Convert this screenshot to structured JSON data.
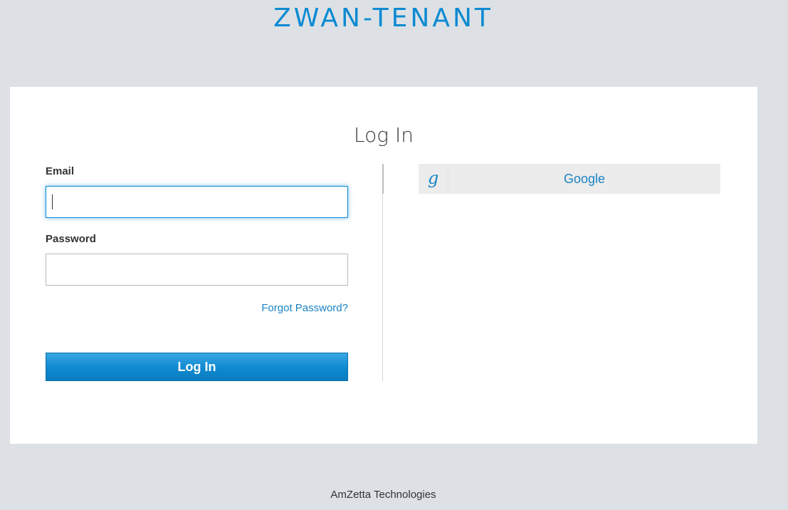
{
  "header": {
    "realm_name": "ZWAN-TENANT"
  },
  "login": {
    "title": "Log In",
    "email_label": "Email",
    "email_value": "",
    "password_label": "Password",
    "password_value": "",
    "forgot_password": "Forgot Password?",
    "submit_label": "Log In"
  },
  "social": {
    "providers": [
      {
        "icon": "google-g-icon",
        "icon_glyph": "g",
        "label": "Google"
      }
    ]
  },
  "footer": {
    "company": "AmZetta Technologies"
  },
  "colors": {
    "accent": "#0b8ad2",
    "link": "#1a83c4",
    "background": "#dde1e5",
    "card": "#ffffff"
  }
}
